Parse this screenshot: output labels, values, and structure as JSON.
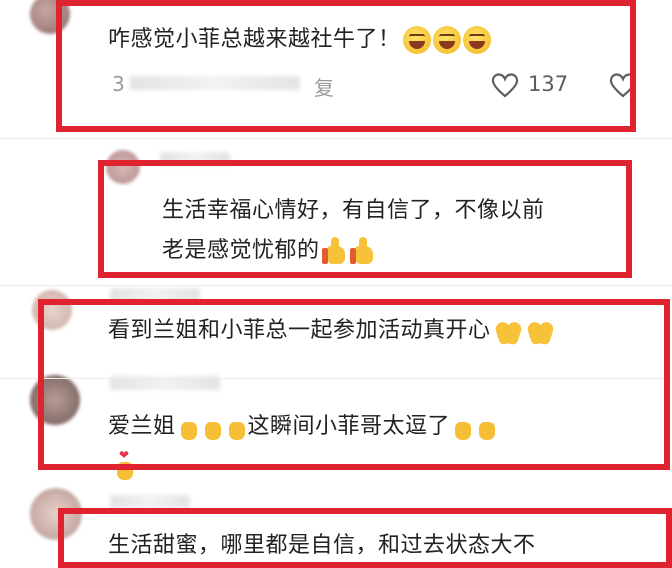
{
  "comments": [
    {
      "text": "咋感觉小菲总越来越社牛了！",
      "meta_prefix": "3",
      "meta_suffix": "复",
      "likes": "137",
      "emoji": [
        "laughing-face",
        "laughing-face",
        "laughing-face"
      ]
    },
    {
      "line1": "生活幸福心情好，有自信了，不像以前",
      "line2": "老是感觉忧郁的",
      "emoji": [
        "thumbs-up",
        "thumbs-up"
      ]
    },
    {
      "text": "看到兰姐和小菲总一起参加活动真开心",
      "emoji": [
        "clapping-hands",
        "clapping-hands"
      ]
    },
    {
      "text_a": "爱兰姐",
      "text_b": "这瞬间小菲哥太逗了",
      "emoji": [
        "heart-hands"
      ]
    },
    {
      "text": "生活甜蜜，哪里都是自信，和过去状态大不"
    }
  ],
  "colors": {
    "highlight_box": "#e0242f",
    "like_gray": "#5d5d5d"
  }
}
